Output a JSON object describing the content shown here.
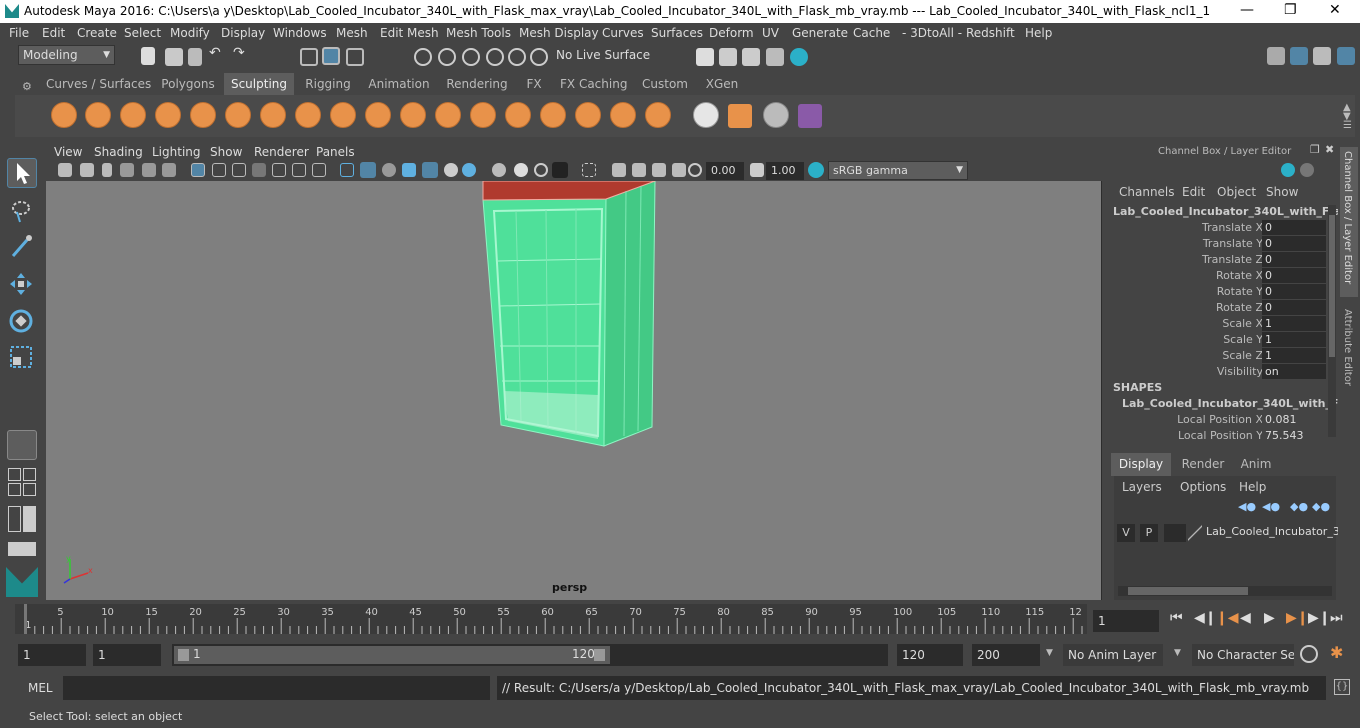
{
  "window": {
    "title": "Autodesk Maya 2016: C:\\Users\\a y\\Desktop\\Lab_Cooled_Incubator_340L_with_Flask_max_vray\\Lab_Cooled_Incubator_340L_with_Flask_mb_vray.mb  ---  Lab_Cooled_Incubator_340L_with_Flask_ncl1_1"
  },
  "menus": [
    "File",
    "Edit",
    "Create",
    "Select",
    "Modify",
    "Display",
    "Windows",
    "Mesh",
    "Edit Mesh",
    "Mesh Tools",
    "Mesh Display",
    "Curves",
    "Surfaces",
    "Deform",
    "UV",
    "Generate",
    "Cache",
    "- 3DtoAll -",
    "Redshift",
    "Help"
  ],
  "status": {
    "mode": "Modeling",
    "live_surface": "No Live Surface"
  },
  "shelf_tabs": [
    "Curves / Surfaces",
    "Polygons",
    "Sculpting",
    "Rigging",
    "Animation",
    "Rendering",
    "FX",
    "FX Caching",
    "Custom",
    "XGen"
  ],
  "shelf_active": "Sculpting",
  "viewport": {
    "menu": [
      "View",
      "Shading",
      "Lighting",
      "Show",
      "Renderer",
      "Panels"
    ],
    "exposure": "0.00",
    "gamma": "1.00",
    "colorspace": "sRGB gamma",
    "camera_label": "persp"
  },
  "channel_box": {
    "header": "Channel Box / Layer Editor",
    "menu": [
      "Channels",
      "Edit",
      "Object",
      "Show"
    ],
    "object_name": "Lab_Cooled_Incubator_340L_with_Flas...",
    "attributes": [
      {
        "name": "Translate X",
        "value": "0"
      },
      {
        "name": "Translate Y",
        "value": "0"
      },
      {
        "name": "Translate Z",
        "value": "0"
      },
      {
        "name": "Rotate X",
        "value": "0"
      },
      {
        "name": "Rotate Y",
        "value": "0"
      },
      {
        "name": "Rotate Z",
        "value": "0"
      },
      {
        "name": "Scale X",
        "value": "1"
      },
      {
        "name": "Scale Y",
        "value": "1"
      },
      {
        "name": "Scale Z",
        "value": "1"
      },
      {
        "name": "Visibility",
        "value": "on"
      }
    ],
    "shapes_label": "SHAPES",
    "shape_name": "Lab_Cooled_Incubator_340L_with_Fl...",
    "shape_attributes": [
      {
        "name": "Local Position X",
        "value": "0.081"
      },
      {
        "name": "Local Position Y",
        "value": "75.543"
      }
    ]
  },
  "layer_editor": {
    "tabs": [
      "Display",
      "Render",
      "Anim"
    ],
    "active_tab": "Display",
    "menu": [
      "Layers",
      "Options",
      "Help"
    ],
    "layer": {
      "v": "V",
      "p": "P",
      "name": "Lab_Cooled_Incubator_3"
    }
  },
  "side_tabs": [
    "Channel Box / Layer Editor",
    "Attribute Editor"
  ],
  "timeline": {
    "ticks": [
      "5",
      "10",
      "15",
      "20",
      "25",
      "30",
      "35",
      "40",
      "45",
      "50",
      "55",
      "60",
      "65",
      "70",
      "75",
      "80",
      "85",
      "90",
      "95",
      "100",
      "105",
      "110",
      "115",
      "12"
    ],
    "start_label": "1",
    "current_frame": "1"
  },
  "range": {
    "start": "1",
    "playback_start": "1",
    "slider_start": "1",
    "slider_end": "120",
    "playback_end": "120",
    "end": "200",
    "anim_layer": "No Anim Layer",
    "char_set": "No Character Set"
  },
  "command": {
    "label": "MEL",
    "result": "// Result: C:/Users/a y/Desktop/Lab_Cooled_Incubator_340L_with_Flask_max_vray/Lab_Cooled_Incubator_340L_with_Flask_mb_vray.mb"
  },
  "help_line": "Select Tool: select an object",
  "colors": {
    "accent": "#5285a6",
    "wire": "#6fe8a8",
    "top_face": "#b03a2e",
    "bg": "#444444",
    "viewport": "#7f7f7f"
  }
}
